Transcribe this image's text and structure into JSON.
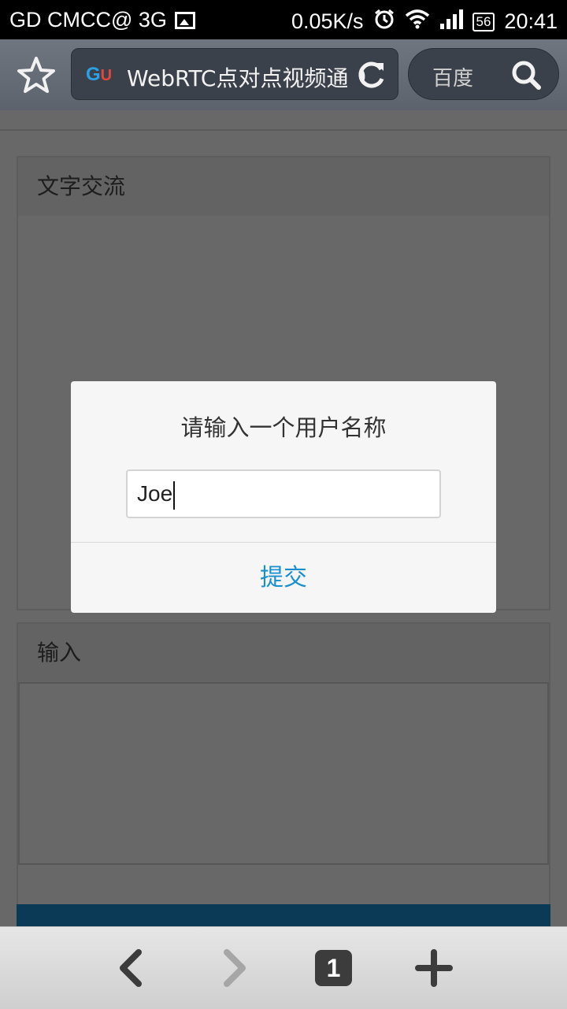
{
  "status_bar": {
    "carrier": "GD CMCC@ 3G",
    "speed": "0.05K/s",
    "battery": "56",
    "time": "20:41"
  },
  "browser": {
    "favicon_text_g": "G",
    "favicon_text_u": "U",
    "url_title": "WebRTC点对点视频通话",
    "search_engine": "百度",
    "tab_count": "1"
  },
  "page": {
    "panel_chat_title": "文字交流",
    "panel_input_title": "输入",
    "send_button_label": ""
  },
  "dialog": {
    "title": "请输入一个用户名称",
    "input_value": "Joe",
    "submit_label": "提交"
  },
  "colors": {
    "accent": "#1a8fcf",
    "overlay": "#686868",
    "send_bar": "#0a3a55"
  }
}
